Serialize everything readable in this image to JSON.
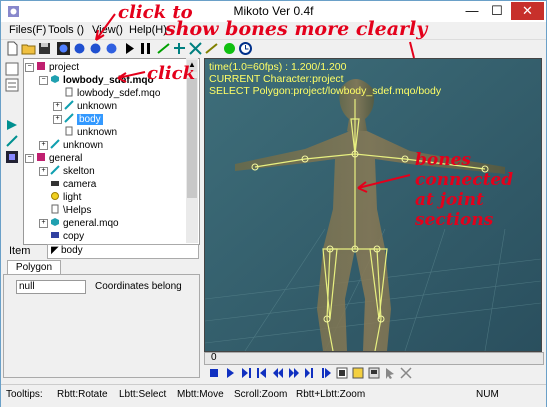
{
  "window": {
    "title": "Mikoto Ver 0.4f",
    "controls": {
      "minimize": "—",
      "maximize": "☐",
      "close": "✕"
    }
  },
  "menu": [
    {
      "label": "Files(F)"
    },
    {
      "label": "Tools ()"
    },
    {
      "label": "View()"
    },
    {
      "label": "Help(H)"
    }
  ],
  "toolbar": {
    "icons": [
      "new-file-icon",
      "open-folder-icon",
      "save-icon",
      "blue-sphere-icon",
      "blue-sphere-icon",
      "blue-sphere-icon",
      "play-icon",
      "pause-icon",
      "bone-icon",
      "bone-icon",
      "bone-icon",
      "bone-icon",
      "green-circle-icon",
      "clock-icon"
    ]
  },
  "tree": [
    {
      "label": "project",
      "indent": 0,
      "icon": "folder-icon",
      "expander": "−",
      "bold": false
    },
    {
      "label": "lowbody_sdef.mqo",
      "indent": 1,
      "icon": "cube-icon",
      "expander": "−",
      "bold": true
    },
    {
      "label": "lowbody_sdef.mqo",
      "indent": 2,
      "icon": "doc-icon",
      "expander": "",
      "bold": false
    },
    {
      "label": "unknown",
      "indent": 2,
      "icon": "bone-icon",
      "expander": "+",
      "bold": false
    },
    {
      "label": "body",
      "indent": 2,
      "icon": "bone-icon",
      "expander": "+",
      "bold": false,
      "selected": true
    },
    {
      "label": "unknown",
      "indent": 2,
      "icon": "doc-icon",
      "expander": "",
      "bold": false
    },
    {
      "label": "unknown",
      "indent": 1,
      "icon": "bone-icon",
      "expander": "+",
      "bold": false
    },
    {
      "label": "general",
      "indent": 0,
      "icon": "folder-icon",
      "expander": "−",
      "bold": false
    },
    {
      "label": "skelton",
      "indent": 1,
      "icon": "bone-icon",
      "expander": "+",
      "bold": false
    },
    {
      "label": "camera",
      "indent": 1,
      "icon": "camera-icon",
      "expander": "",
      "bold": false
    },
    {
      "label": "light",
      "indent": 1,
      "icon": "light-icon",
      "expander": "",
      "bold": false
    },
    {
      "label": "\\Helps",
      "indent": 1,
      "icon": "doc-icon",
      "expander": "",
      "bold": false
    },
    {
      "label": "general.mqo",
      "indent": 1,
      "icon": "cube-icon",
      "expander": "+",
      "bold": false
    },
    {
      "label": "copy",
      "indent": 1,
      "icon": "copy-icon",
      "expander": "",
      "bold": false
    }
  ],
  "item": {
    "label": "Item",
    "value": "body"
  },
  "tabs": [
    {
      "label": "Polygon"
    }
  ],
  "polygon_panel": {
    "field_value": "null",
    "field_caption": "Coordinates belong"
  },
  "viewport": {
    "info": [
      "time(1.0=60fps) : 1.200/1.200",
      "CURRENT Character:project",
      "SELECT Polygon:project/lowbody_sdef.mqo/body"
    ]
  },
  "timeline": {
    "marker": "0"
  },
  "transport": {
    "icons": [
      "stop-icon",
      "play-icon",
      "frame-end-icon",
      "frame-start-icon",
      "rewind-icon",
      "forward-icon",
      "skip-icon",
      "skip-end-icon",
      "record-icon",
      "frame-icon",
      "export-icon",
      "cursor-icon",
      "fit-icon"
    ]
  },
  "status": {
    "tooltips": "Tooltips:",
    "rotate": "Rbtt:Rotate",
    "select": "Lbtt:Select",
    "move": "Mbtt:Move",
    "scroll_zoom": "Scroll:Zoom",
    "rl_zoom": "Rbtt+Lbtt:Zoom",
    "num": "NUM"
  },
  "annotations": {
    "top_1": "click to",
    "top_2": "show bones more clearly",
    "click": "click",
    "bones": [
      "bones",
      "connected",
      "at joint",
      "sections"
    ]
  },
  "colors": {
    "annotation": "#e4001b",
    "viewport_bg": "#2f5a6a",
    "info_text": "#ffff66",
    "selection": "#3399ff"
  }
}
